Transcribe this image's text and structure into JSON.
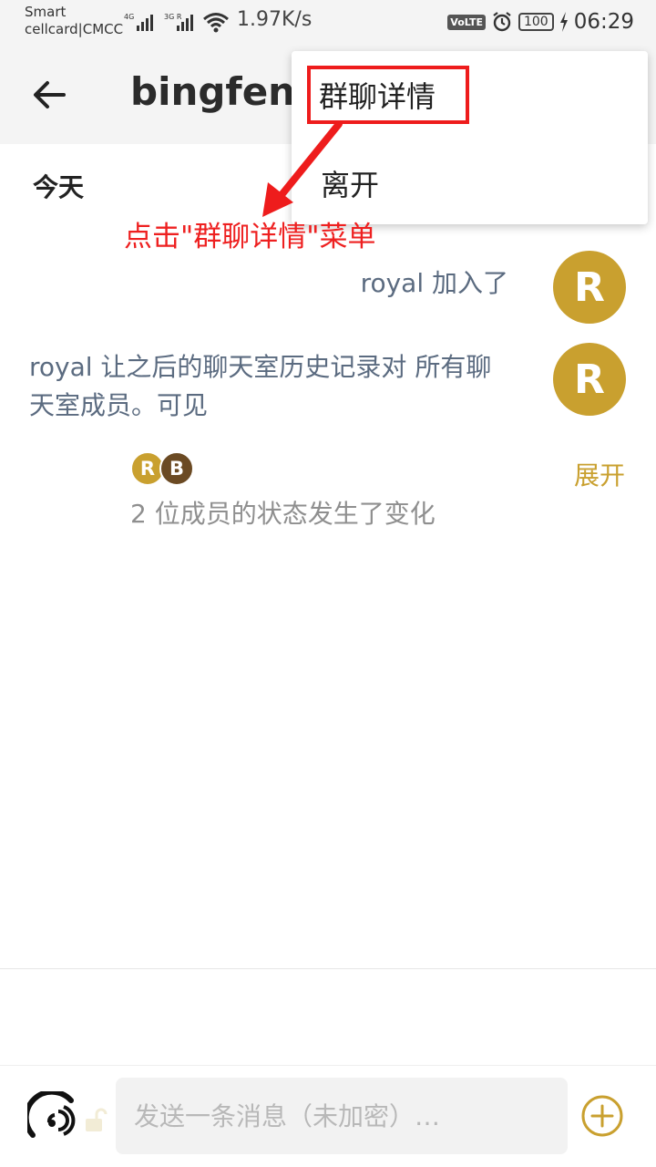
{
  "status_bar": {
    "carrier_line1": "Smart",
    "carrier_line2": "cellcard|CMCC",
    "net1": "4G",
    "net2": "3G R",
    "netspeed": "1.97K/s",
    "volte": "VoLTE",
    "battery": "100",
    "time": "06:29",
    "icons": [
      "signal-icon",
      "wifi-icon",
      "alarm-icon",
      "battery-icon",
      "charging-icon"
    ]
  },
  "header": {
    "title": "bingfeng",
    "back_icon": "arrow-left-icon"
  },
  "menu": {
    "items": [
      "群聊详情",
      "离开"
    ]
  },
  "annotation": {
    "text": "点击\"群聊详情\"菜单",
    "color": "#ee1c1c"
  },
  "timeline": {
    "date_separator": "今天",
    "events": [
      {
        "text": "royal 加入了",
        "avatar_letter": "R"
      },
      {
        "text": "royal 让之后的聊天室历史记录对 所有聊天室成员。可见",
        "avatar_letter": "R"
      }
    ],
    "summary": {
      "avatar_letters": [
        "R",
        "B"
      ],
      "text": "2 位成员的状态发生了变化",
      "expand_label": "展开"
    }
  },
  "composer": {
    "placeholder": "发送一条消息（未加密）…",
    "icons": [
      "e2e-signal-icon",
      "unlocked-icon",
      "plus-circle-icon"
    ]
  },
  "colors": {
    "accent": "#c9a02f",
    "avatar_b": "#6b4a23",
    "event_text": "#5b6b80",
    "annotation_red": "#ee1c1c"
  }
}
